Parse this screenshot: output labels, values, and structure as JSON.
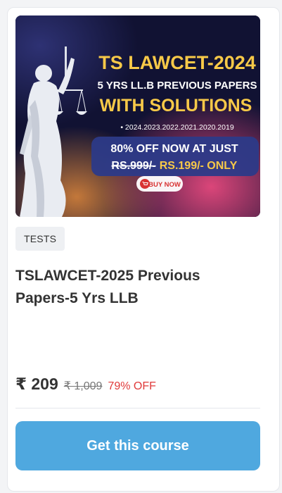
{
  "banner": {
    "title": "TS LAWCET-2024",
    "subtitle": "5 YRS LL.B PREVIOUS PAPERS",
    "headline": "WITH SOLUTIONS",
    "years": "• 2024.2023.2022.2021.2020.2019",
    "offer_line1": "80% OFF NOW AT JUST",
    "offer_old": "RS.999/-",
    "offer_new": "RS.199/- ONLY",
    "buy_now": "BUY NOW",
    "colors": {
      "background": "#111233",
      "title_yellow": "#f7c948",
      "offer_panel": "#2c3a88",
      "buy_red": "#d83232"
    }
  },
  "card": {
    "badge": "TESTS",
    "title": "TSLAWCET-2025 Previous Papers-5 Yrs LLB",
    "price": "₹ 209",
    "old_price": "₹ 1,009",
    "discount": "79% OFF",
    "cta": "Get this course",
    "colors": {
      "cta": "#4fa8df",
      "discount": "#e03a3a"
    }
  }
}
